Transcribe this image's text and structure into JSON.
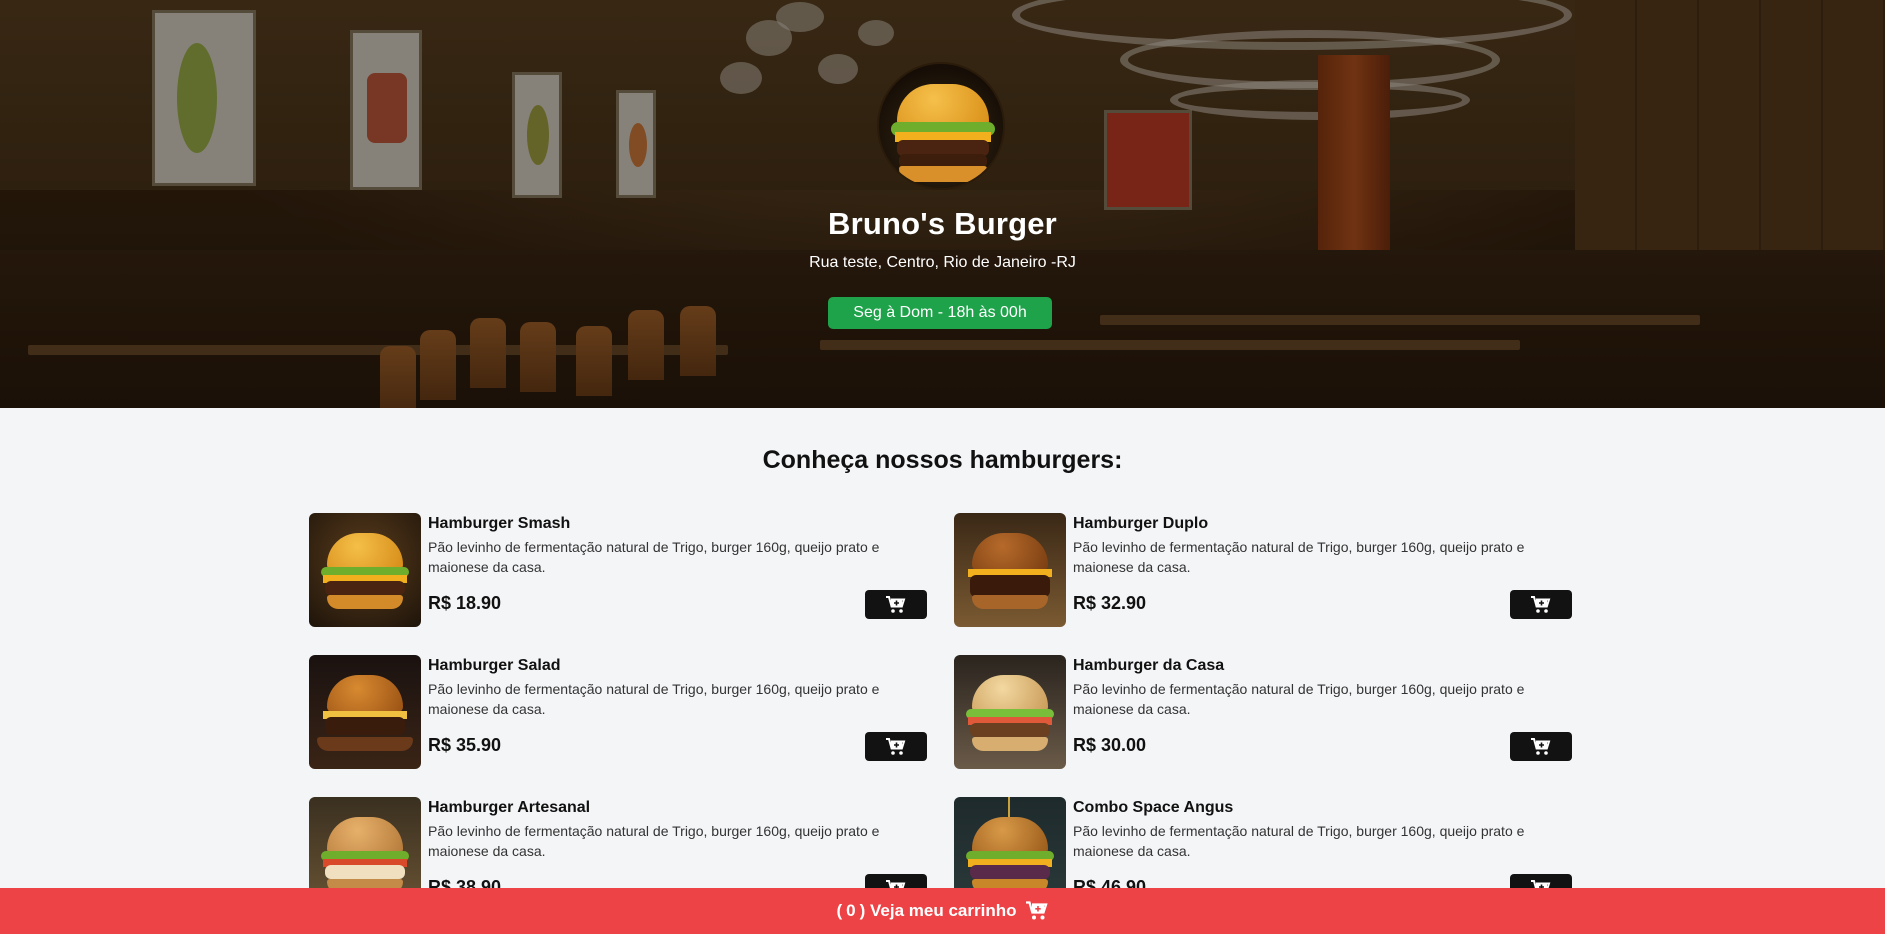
{
  "header": {
    "store_name": "Bruno's Burger",
    "address": "Rua teste, Centro, Rio de Janeiro -RJ",
    "hours": "Seg à Dom - 18h às 00h",
    "hours_color": "#1ea34a"
  },
  "menu": {
    "title": "Conheça nossos hamburgers:",
    "items": [
      {
        "name": "Hamburger Smash",
        "description": "Pão levinho de fermentação natural de Trigo, burger 160g, queijo prato e maionese da casa.",
        "price": "R$ 18.90",
        "icon": "cart-plus-icon"
      },
      {
        "name": "Hamburger Duplo",
        "description": "Pão levinho de fermentação natural de Trigo, burger 160g, queijo prato e maionese da casa.",
        "price": "R$ 32.90",
        "icon": "cart-plus-icon"
      },
      {
        "name": "Hamburger Salad",
        "description": "Pão levinho de fermentação natural de Trigo, burger 160g, queijo prato e maionese da casa.",
        "price": "R$ 35.90",
        "icon": "cart-plus-icon"
      },
      {
        "name": "Hamburger da Casa",
        "description": "Pão levinho de fermentação natural de Trigo, burger 160g, queijo prato e maionese da casa.",
        "price": "R$ 30.00",
        "icon": "cart-plus-icon"
      },
      {
        "name": "Hamburger Artesanal",
        "description": "Pão levinho de fermentação natural de Trigo, burger 160g, queijo prato e maionese da casa.",
        "price": "R$ 38.90",
        "icon": "cart-plus-icon"
      },
      {
        "name": "Combo Space Angus",
        "description": "Pão levinho de fermentação natural de Trigo, burger 160g, queijo prato e maionese da casa.",
        "price": "R$ 46.90",
        "icon": "cart-plus-icon"
      }
    ]
  },
  "cart": {
    "open_paren": "(",
    "count": "0",
    "label": ") Veja meu carrinho",
    "bar_color": "#ee4346",
    "icon": "shopping-cart-icon"
  }
}
